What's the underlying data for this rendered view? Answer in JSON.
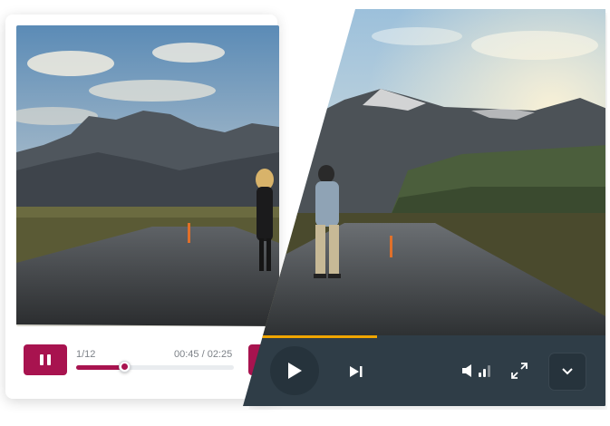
{
  "light_player": {
    "counter": "1/12",
    "time": "00:45 / 02:25",
    "progress": 0.31,
    "accent": "#a8134f",
    "icons": {
      "pause": "pause-icon"
    }
  },
  "dark_player": {
    "progress": 0.38,
    "accent": "#f0a500",
    "bar_color": "#2f3d47",
    "volume_level": 0.7,
    "icons": {
      "play": "play-icon",
      "next": "skip-next-icon",
      "volume": "volume-icon",
      "fullscreen": "fullscreen-icon",
      "menu": "chevron-down-icon"
    }
  }
}
